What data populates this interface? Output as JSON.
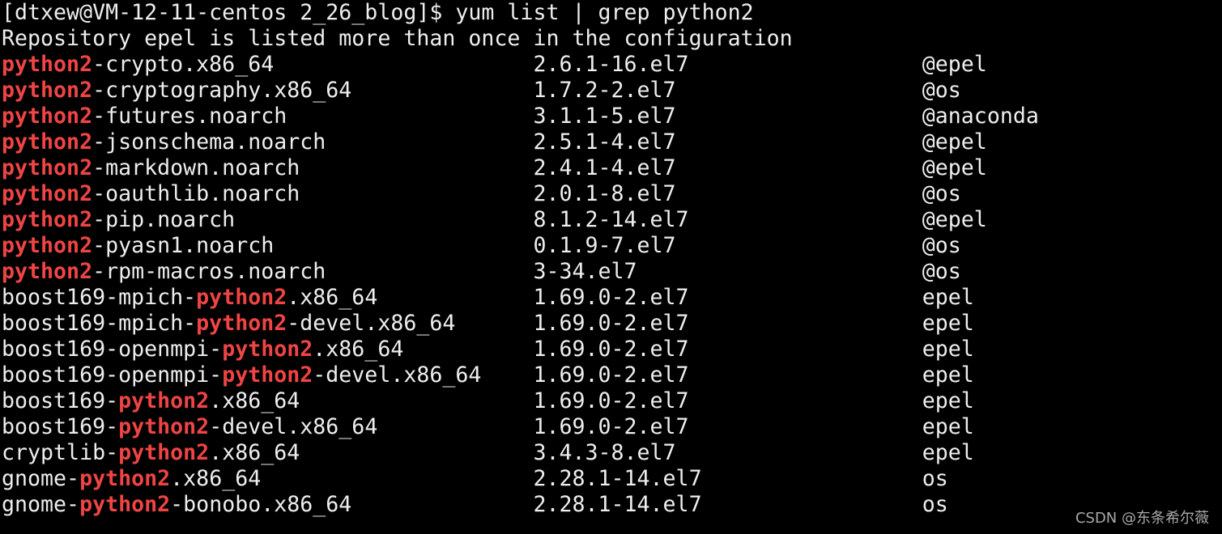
{
  "prompt": "[dtxew@VM-12-11-centos 2_26_blog]$ yum list | grep python2",
  "notice": "Repository epel is listed more than once in the configuration",
  "highlight_color": "#ef4444",
  "rows": [
    {
      "pre": "",
      "match": "python2",
      "post": "-crypto.x86_64",
      "version": "2.6.1-16.el7",
      "repo": "@epel"
    },
    {
      "pre": "",
      "match": "python2",
      "post": "-cryptography.x86_64",
      "version": "1.7.2-2.el7",
      "repo": "@os"
    },
    {
      "pre": "",
      "match": "python2",
      "post": "-futures.noarch",
      "version": "3.1.1-5.el7",
      "repo": "@anaconda"
    },
    {
      "pre": "",
      "match": "python2",
      "post": "-jsonschema.noarch",
      "version": "2.5.1-4.el7",
      "repo": "@epel"
    },
    {
      "pre": "",
      "match": "python2",
      "post": "-markdown.noarch",
      "version": "2.4.1-4.el7",
      "repo": "@epel"
    },
    {
      "pre": "",
      "match": "python2",
      "post": "-oauthlib.noarch",
      "version": "2.0.1-8.el7",
      "repo": "@os"
    },
    {
      "pre": "",
      "match": "python2",
      "post": "-pip.noarch",
      "version": "8.1.2-14.el7",
      "repo": "@epel"
    },
    {
      "pre": "",
      "match": "python2",
      "post": "-pyasn1.noarch",
      "version": "0.1.9-7.el7",
      "repo": "@os"
    },
    {
      "pre": "",
      "match": "python2",
      "post": "-rpm-macros.noarch",
      "version": "3-34.el7",
      "repo": "@os"
    },
    {
      "pre": "boost169-mpich-",
      "match": "python2",
      "post": ".x86_64",
      "version": "1.69.0-2.el7",
      "repo": "epel"
    },
    {
      "pre": "boost169-mpich-",
      "match": "python2",
      "post": "-devel.x86_64",
      "version": "1.69.0-2.el7",
      "repo": "epel"
    },
    {
      "pre": "boost169-openmpi-",
      "match": "python2",
      "post": ".x86_64",
      "version": "1.69.0-2.el7",
      "repo": "epel"
    },
    {
      "pre": "boost169-openmpi-",
      "match": "python2",
      "post": "-devel.x86_64",
      "version": "1.69.0-2.el7",
      "repo": "epel"
    },
    {
      "pre": "boost169-",
      "match": "python2",
      "post": ".x86_64",
      "version": "1.69.0-2.el7",
      "repo": "epel"
    },
    {
      "pre": "boost169-",
      "match": "python2",
      "post": "-devel.x86_64",
      "version": "1.69.0-2.el7",
      "repo": "epel"
    },
    {
      "pre": "cryptlib-",
      "match": "python2",
      "post": ".x86_64",
      "version": "3.4.3-8.el7",
      "repo": "epel"
    },
    {
      "pre": "gnome-",
      "match": "python2",
      "post": ".x86_64",
      "version": "2.28.1-14.el7",
      "repo": "os"
    },
    {
      "pre": "gnome-",
      "match": "python2",
      "post": "-bonobo.x86_64",
      "version": "2.28.1-14.el7",
      "repo": "os"
    }
  ],
  "watermark": "CSDN @东条希尔薇"
}
